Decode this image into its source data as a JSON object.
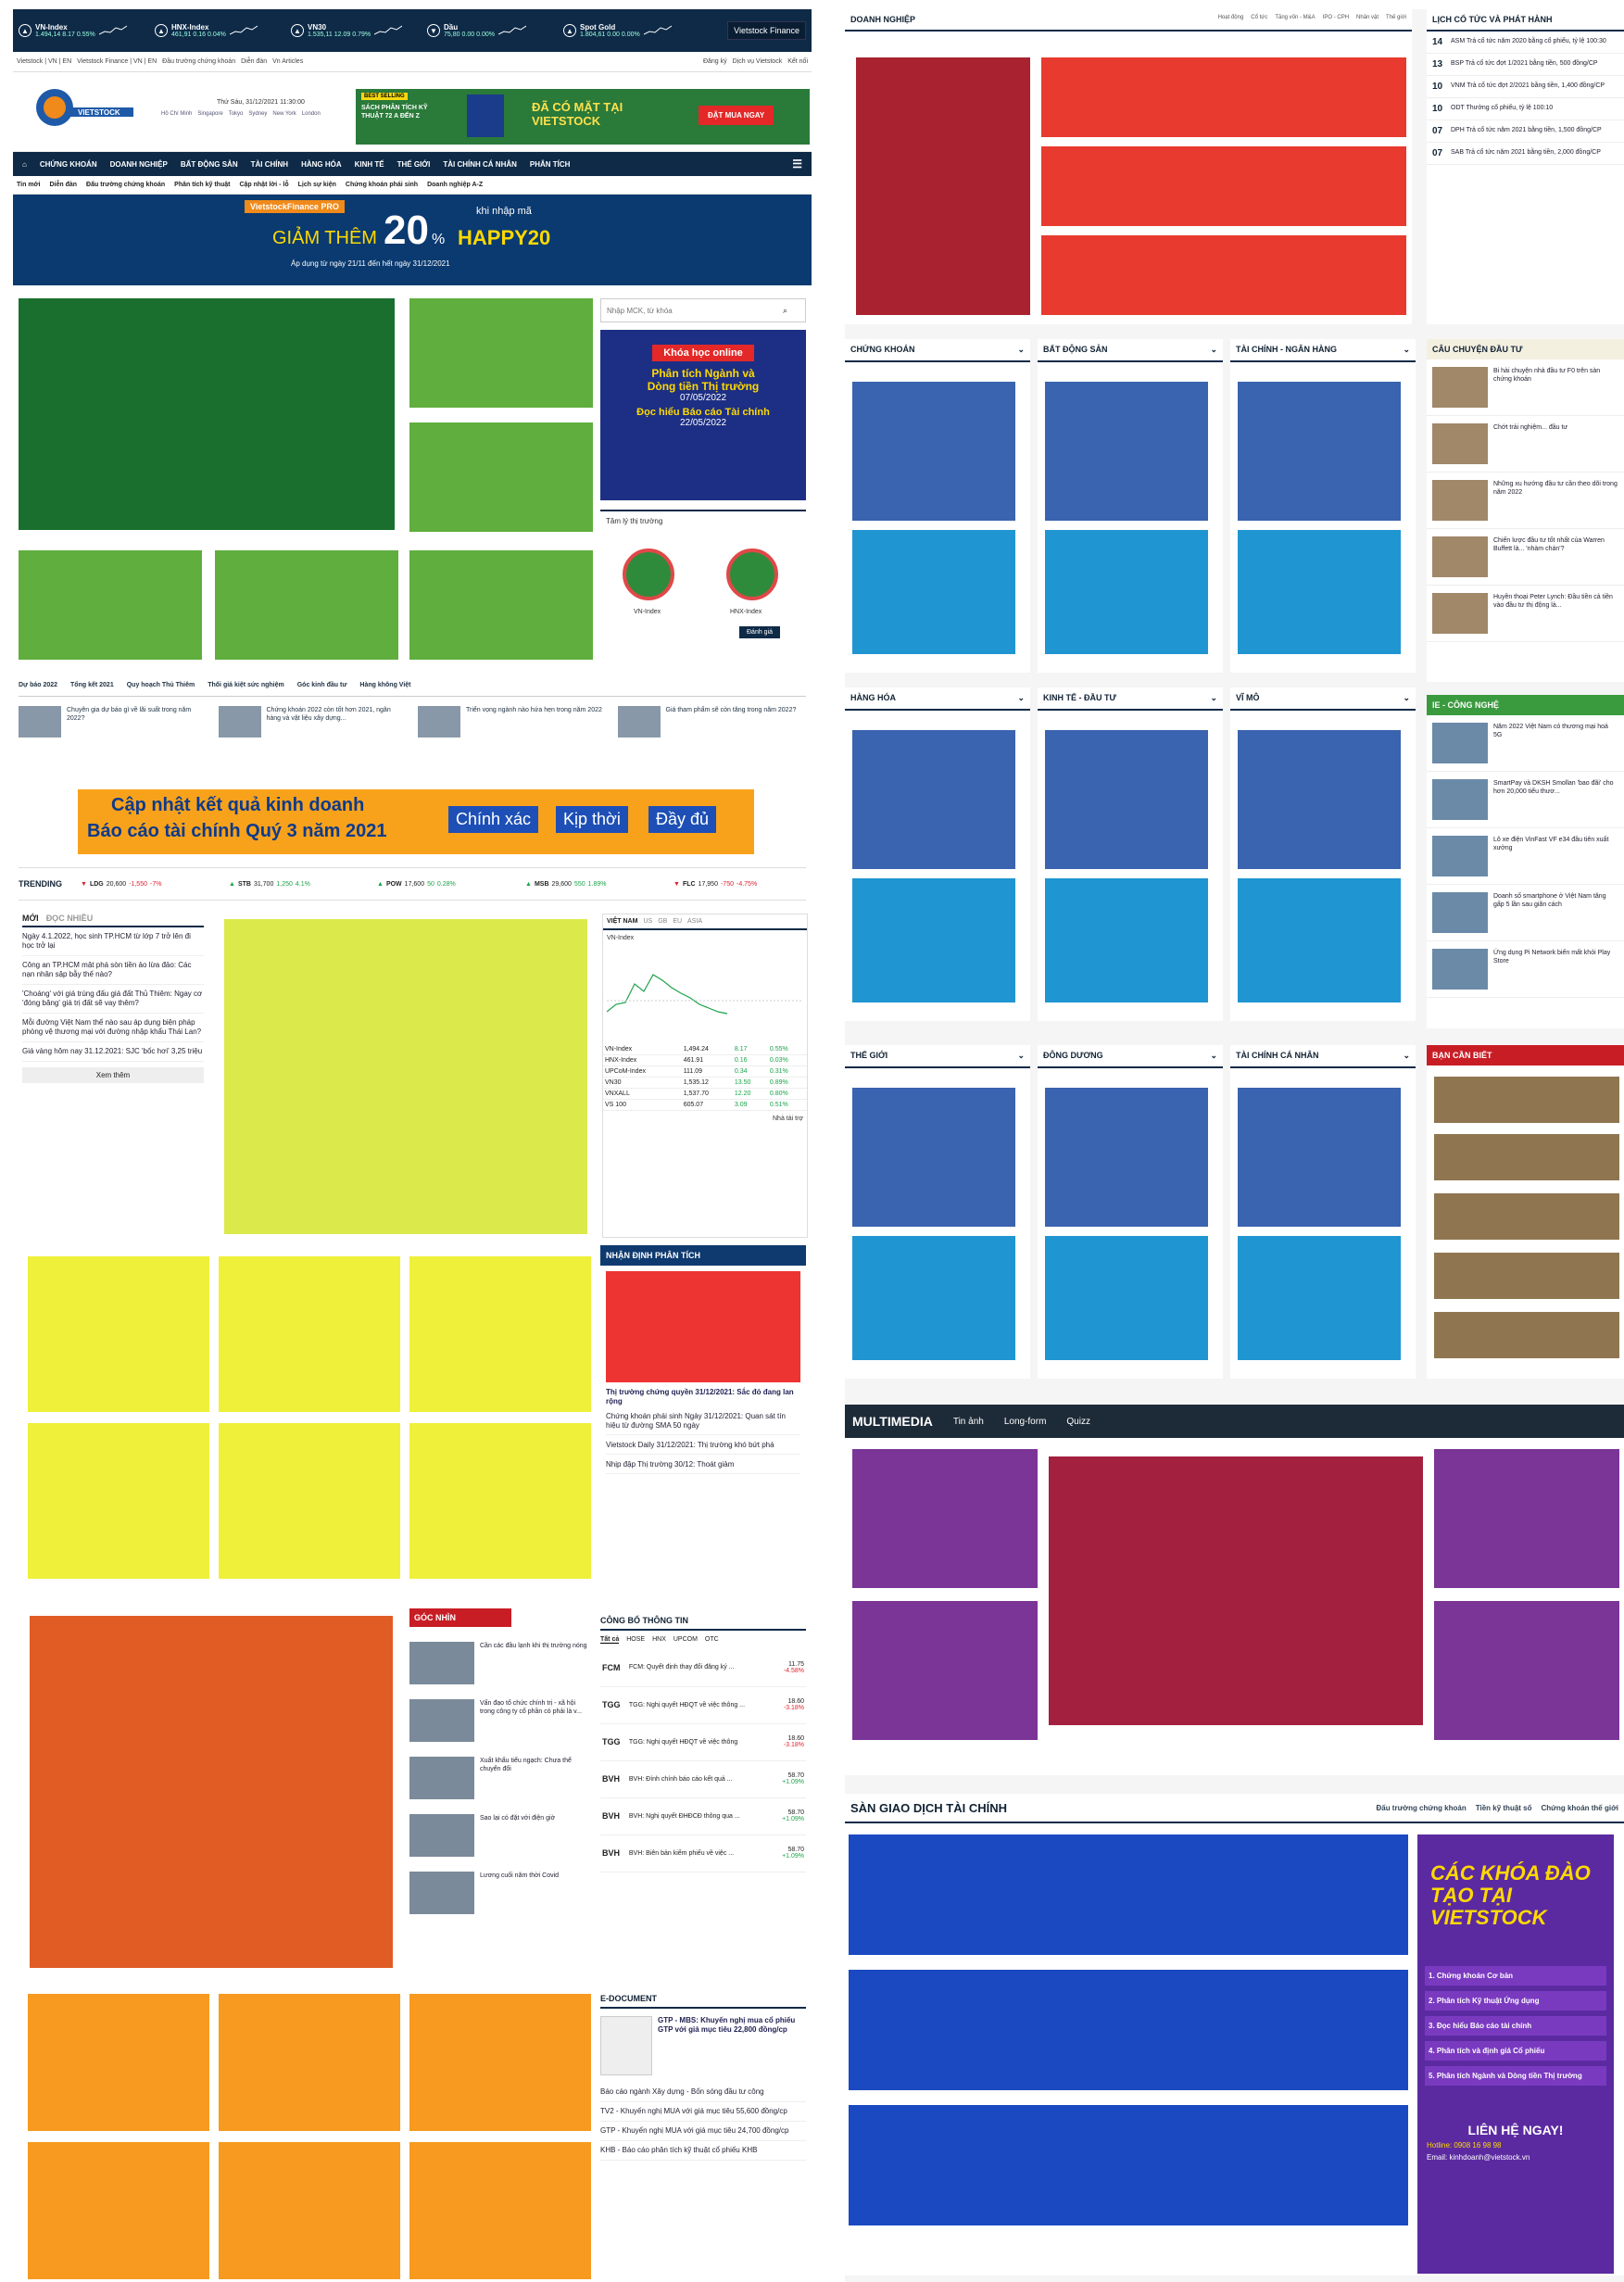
{
  "ticker": [
    {
      "name": "VN-Index",
      "value": "1.494,14",
      "change": "8.17",
      "pct": "0.55%"
    },
    {
      "name": "HNX-Index",
      "value": "461,91",
      "change": "0.16",
      "pct": "0.04%"
    },
    {
      "name": "VN30",
      "value": "1.535,11",
      "change": "12.09",
      "pct": "0.79%"
    },
    {
      "name": "Dầu",
      "value": "75,80",
      "change": "0.00",
      "pct": "0.00%"
    },
    {
      "name": "Spot Gold",
      "value": "1.804,61",
      "change": "0.00",
      "pct": "0.00%"
    }
  ],
  "ticker_dropdown": "Vietstock Finance",
  "topbar": {
    "left": [
      "Vietstock | VN | EN",
      "Vietstock Finance | VN | EN",
      "Đầu trường chứng khoán",
      "Diễn đàn",
      "Vn Articles"
    ],
    "right": [
      "Đăng ký",
      "Dịch vụ Vietstock",
      "Kết nối"
    ]
  },
  "header": {
    "logo": "VIETSTOCK",
    "slogan": "Kết nối - Chia sẻ - Thành công",
    "date": "Thứ Sáu, 31/12/2021 11:30:00",
    "ad_tag": "BEST SELLING",
    "ad_book": "SÁCH PHÂN TÍCH KỸ THUẬT 72 A ĐẾN Z",
    "ad_main": "ĐÃ CÓ MẶT TẠI VIETSTOCK",
    "ad_btn": "ĐẶT MUA NGAY",
    "cities": [
      "Hồ Chí Minh",
      "Singapore",
      "Tokyo",
      "Sydney",
      "New York",
      "London"
    ]
  },
  "nav": [
    "CHỨNG KHOÁN",
    "DOANH NGHIỆP",
    "BẤT ĐỘNG SẢN",
    "TÀI CHÍNH",
    "HÀNG HÓA",
    "KINH TẾ",
    "THẾ GIỚI",
    "TÀI CHÍNH CÁ NHÂN",
    "PHÂN TÍCH"
  ],
  "subnav": [
    "Tin mới",
    "Diễn đàn",
    "Đấu trường chứng khoán",
    "Phân tích kỹ thuật",
    "Cập nhật lời - lỗ",
    "Lịch sự kiện",
    "Chứng khoán phái sinh",
    "Doanh nghiệp A-Z"
  ],
  "promo": {
    "badge": "VietstockFinance PRO",
    "left": "GIẢM THÊM",
    "num": "20",
    "pct": "%",
    "right_small": "khi nhập mã",
    "code": "HAPPY20",
    "note": "Áp dụng từ ngày 21/11 đến hết ngày 31/12/2021"
  },
  "search_placeholder": "Nhập MCK, từ khóa",
  "course_ad": {
    "title": "Khóa học online",
    "l1": "Phân tích Ngành và",
    "l2": "Dòng tiền Thị trường",
    "d1": "07/05/2022",
    "l3": "Đọc hiểu Báo cáo Tài chính",
    "d2": "22/05/2022"
  },
  "mood": {
    "title": "Tâm lý thị trường",
    "a": "VN-Index",
    "b": "HNX-Index",
    "btn": "Đánh giá"
  },
  "tabs_row": [
    "Dự báo 2022",
    "Tổng kết 2021",
    "Quy hoạch Thủ Thiêm",
    "Thối giá kiệt sức nghiệm",
    "Góc kinh đầu tư",
    "Hàng không Việt"
  ],
  "news4": [
    "Chuyên gia dự báo gì về lãi suất trong năm 2022?",
    "Chứng khoán 2022 còn tốt hơn 2021, ngân hàng và vật liệu xây dựng...",
    "Triển vọng ngành nào hứa hẹn trong năm 2022",
    "Giá tham phẩm sẽ còn tăng trong năm 2022?"
  ],
  "report_banner": {
    "l1": "Cập nhật kết quả kinh doanh",
    "l2": "Báo cáo tài chính Quý 3 năm 2021",
    "b1": "Chính xác",
    "b2": "Kịp thời",
    "b3": "Đầy đủ"
  },
  "trending": {
    "label": "TRENDING",
    "items": [
      {
        "s": "LDG",
        "v": "20,600",
        "c": "-1,550",
        "p": "-7%"
      },
      {
        "s": "STB",
        "v": "31,700",
        "c": "1,250",
        "p": "4.1%"
      },
      {
        "s": "POW",
        "v": "17,600",
        "c": "50",
        "p": "0.28%"
      },
      {
        "s": "MSB",
        "v": "29,600",
        "c": "550",
        "p": "1.89%"
      },
      {
        "s": "FLC",
        "v": "17,950",
        "c": "-750",
        "p": "-4.75%"
      }
    ]
  },
  "latest": {
    "tabs": [
      "MỚI",
      "ĐỌC NHIỀU"
    ],
    "items": [
      "Ngày 4.1.2022, học sinh TP.HCM từ lớp 7 trở lên đi học trở lại",
      "Công an TP.HCM mật phá sòn tiền ảo lừa đảo: Các nạn nhân sập bẫy thế nào?",
      "'Choáng' với giá trúng đấu giá đất Thủ Thiêm: Ngay cơ 'đóng băng' giá trị đất sẽ vay thêm?",
      "Mỗi đường Việt Nam thế nào sau áp dụng biện pháp phòng vệ thương mại với đường nhập khẩu Thái Lan?",
      "Giá vàng hôm nay 31.12.2021: SJC 'bốc hơi' 3,25 triệu"
    ],
    "more": "Xem thêm"
  },
  "market": {
    "tabs": [
      "VIỆT NAM",
      "US",
      "GB",
      "EU",
      "ASIA"
    ],
    "chart_title": "VN-Index",
    "rows": [
      [
        "VN-Index",
        "1,494.24",
        "8.17",
        "0.55%"
      ],
      [
        "HNX-Index",
        "461.91",
        "0.16",
        "0.03%"
      ],
      [
        "UPCoM-Index",
        "111.09",
        "0.34",
        "0.31%"
      ],
      [
        "VN30",
        "1,535.12",
        "13.50",
        "0.89%"
      ],
      [
        "VNXALL",
        "1,537.70",
        "12.20",
        "0.80%"
      ],
      [
        "VS 100",
        "605.07",
        "3.09",
        "0.51%"
      ]
    ],
    "sponsor": "Nhà tài trợ"
  },
  "analysis": {
    "title": "NHẬN ĐỊNH PHÂN TÍCH",
    "headline": "Thị trường chứng quyền 31/12/2021: Sắc đỏ đang lan rộng",
    "items": [
      "Chứng khoán phái sinh Ngày 31/12/2021: Quan sát tín hiệu từ đường SMA 50 ngày",
      "Vietstock Daily 31/12/2021: Thị trường khó bứt phá",
      "Nhịp đập Thị trường 30/12: Thoát giảm"
    ]
  },
  "gocnhin": {
    "title": "GÓC NHÌN",
    "items": [
      "Cần các đầu lạnh khi thị trường nóng",
      "Vấn đạo tổ chức chính trị - xã hội trong công ty cổ phần có phải là v...",
      "Xuất khẩu tiểu ngạch: Chưa thể chuyển đổi",
      "Sao lại có đặt với điện giờ",
      "Lương cuối năm thời Covid"
    ]
  },
  "disclosure": {
    "title": "CÔNG BỐ THÔNG TIN",
    "tabs": [
      "Tất cả",
      "HOSE",
      "HNX",
      "UPCOM",
      "OTC"
    ],
    "rows": [
      [
        "FCM",
        "FCM: Quyết định thay đổi đăng ký ...",
        "11.75",
        "-4.58%"
      ],
      [
        "TGG",
        "TGG: Nghị quyết HĐQT về việc thông ...",
        "18.60",
        "-3.18%"
      ],
      [
        "TGG",
        "TGG: Nghị quyết HĐQT về việc thông",
        "18.60",
        "-3.18%"
      ],
      [
        "BVH",
        "BVH: Đính chính báo cáo kết quả ...",
        "58.70",
        "+1.09%"
      ],
      [
        "BVH",
        "BVH: Nghị quyết ĐHĐCĐ thông qua ...",
        "58.70",
        "+1.09%"
      ],
      [
        "BVH",
        "BVH: Biên bản kiểm phiếu về việc ...",
        "58.70",
        "+1.09%"
      ]
    ]
  },
  "edoc": {
    "title": "E-DOCUMENT",
    "headline": "GTP - MBS: Khuyến nghị mua cổ phiếu GTP với giá mục tiêu 22,800 đồng/cp",
    "items": [
      "Báo cáo ngành Xây dựng - Bốn sóng đầu tư công",
      "TV2 - Khuyến nghị MUA với giá mục tiêu 55,600 đồng/cp",
      "GTP - Khuyến nghị MUA với giá mục tiêu 24,700 đồng/cp",
      "KHB - Báo cáo phân tích kỹ thuật cổ phiếu KHB"
    ]
  },
  "right": {
    "doanhnghiep": {
      "title": "DOANH NGHIỆP",
      "links": [
        "Hoạt động",
        "Cổ tức",
        "Tăng vốn - M&A",
        "IPO - CPH",
        "Nhân vật",
        "Thế giới"
      ]
    },
    "cotuc": {
      "title": "LỊCH CỔ TỨC VÀ PHÁT HÀNH",
      "items": [
        [
          "14",
          "ASM Trả cổ tức năm 2020 bằng cổ phiếu, tỷ lệ 100:30"
        ],
        [
          "13",
          "BSP Trả cổ tức đợt 1/2021 bằng tiền, 500 đồng/CP"
        ],
        [
          "10",
          "VNM Trả cổ tức đợt 2/2021 bằng tiền, 1,400 đồng/CP"
        ],
        [
          "10",
          "ODT Thưởng cổ phiếu, tỷ lệ 100:10"
        ],
        [
          "07",
          "DPH Trả cổ tức năm 2021 bằng tiền, 1,500 đồng/CP"
        ],
        [
          "07",
          "SAB Trả cổ tức năm 2021 bằng tiền, 2,000 đồng/CP"
        ]
      ]
    },
    "row1": [
      "CHỨNG KHOÁN",
      "BẤT ĐỘNG SẢN",
      "TÀI CHÍNH - NGÂN HÀNG"
    ],
    "row2": [
      "HÀNG HÓA",
      "KINH TẾ - ĐẦU TƯ",
      "VĨ MÔ"
    ],
    "row3": [
      "THẾ GIỚI",
      "ĐÔNG DƯƠNG",
      "TÀI CHÍNH CÁ NHÂN"
    ],
    "story": {
      "title": "CÂU CHUYỆN ĐẦU TƯ",
      "items": [
        "Bi hài chuyện nhà đầu tư F0 trên sàn chứng khoán",
        "Chớt trải nghiệm... đầu tư",
        "Những xu hướng đầu tư cần theo dõi trong năm 2022",
        "Chiến lược đầu tư tốt nhất của Warren Buffett là... 'nhàm chán'?",
        "Huyền thoại Peter Lynch: Đầu tiền cả tiền vào đầu tư thị động là..."
      ]
    },
    "tech": {
      "title": "IE - CÔNG NGHỆ",
      "items": [
        "Năm 2022 Việt Nam có thương mại hoá 5G",
        "SmartPay và DKSH Smollan 'bao đãi' cho hơn 20,000 tiểu thươ...",
        "Lô xe điện VinFast VF e34 đầu tiên xuất xưởng",
        "Doanh số smartphone ở Việt Nam tăng gấp 5 lần sau giãn cách",
        "Ứng dụng Pi Network biến mất khỏi Play Store"
      ]
    },
    "bancan": {
      "title": "BẠN CẦN BIẾT"
    },
    "multimedia": {
      "title": "MULTIMEDIA",
      "tabs": [
        "Tin ảnh",
        "Long-form",
        "Quizz"
      ]
    },
    "exchange": {
      "title": "SÀN GIAO DỊCH TÀI CHÍNH",
      "links": [
        "Đấu trường chứng khoán",
        "Tiền kỹ thuật số",
        "Chứng khoán thế giới"
      ]
    },
    "training": {
      "title": "CÁC KHÓA ĐÀO TẠO TẠI VIETSTOCK",
      "items": [
        "1. Chứng khoán Cơ bản",
        "2. Phân tích Kỹ thuật Ứng dụng",
        "3. Đọc hiểu Báo cáo tài chính",
        "4. Phân tích và định giá Cổ phiếu",
        "5. Phân tích Ngành và Dòng tiền Thị trường"
      ],
      "cta": "LIÊN HỆ NGAY!",
      "hotline": "Hotline: 0908 16 98 98",
      "email": "Email: kinhdoanh@vietstock.vn"
    }
  },
  "colors": {
    "navy": "#0e2a47",
    "green": "#1a6f2e",
    "yellow": "#eef03a",
    "orange": "#f79a1f",
    "red": "#a8232f",
    "blue": "#3a63b0",
    "purple": "#7b3596",
    "brown": "#8f7650"
  }
}
